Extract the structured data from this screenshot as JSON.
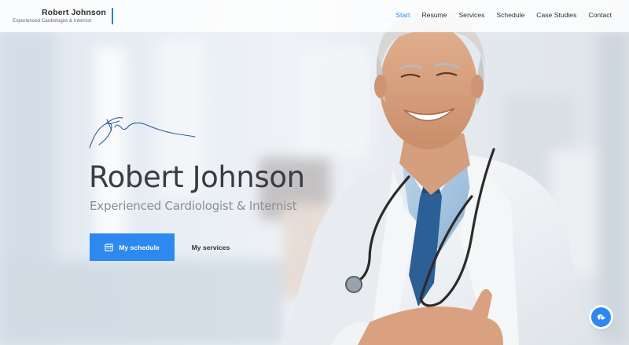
{
  "header": {
    "brand_name": "Robert Johnson",
    "brand_tagline": "Experienced Cardiologist & Internist",
    "nav": [
      {
        "label": "Start",
        "active": true
      },
      {
        "label": "Resume",
        "active": false
      },
      {
        "label": "Services",
        "active": false
      },
      {
        "label": "Schedule",
        "active": false
      },
      {
        "label": "Case Studies",
        "active": false
      },
      {
        "label": "Contact",
        "active": false
      }
    ]
  },
  "hero": {
    "title": "Robert Johnson",
    "subtitle": "Experienced Cardiologist & Internist",
    "primary_button": {
      "label": "My schedule",
      "icon": "calendar-icon"
    },
    "secondary_button": {
      "label": "My services"
    }
  },
  "chat": {
    "icon": "chat-bubbles-icon"
  },
  "colors": {
    "accent": "#2d89ef",
    "title": "#3a3c40",
    "subtitle": "#8a8d92",
    "background": "#e9eef3"
  }
}
